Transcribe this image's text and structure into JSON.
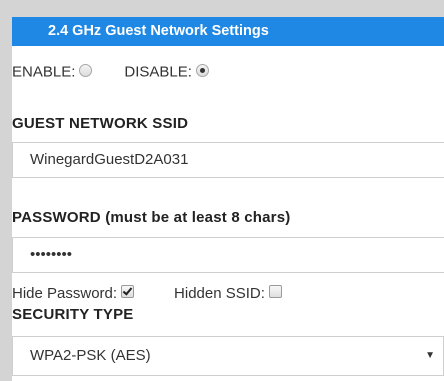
{
  "header": {
    "title": "2.4 GHz Guest Network Settings"
  },
  "enable_row": {
    "enable_label": "ENABLE:",
    "disable_label": "DISABLE:",
    "selected": "disable"
  },
  "ssid": {
    "label": "GUEST NETWORK SSID",
    "value": "WinegardGuestD2A031"
  },
  "password": {
    "label": "PASSWORD (must be at least 8 chars)",
    "value": "••••••••"
  },
  "options": {
    "hide_password_label": "Hide Password:",
    "hide_password_checked": true,
    "hidden_ssid_label": "Hidden SSID:",
    "hidden_ssid_checked": false
  },
  "security": {
    "label": "SECURITY TYPE",
    "selected": "WPA2-PSK (AES)"
  },
  "icons": {
    "dropdown": "chevron-down-icon"
  },
  "colors": {
    "header_bg": "#1f88e5",
    "header_text": "#ffffff",
    "page_bg": "#d4d4d4"
  }
}
